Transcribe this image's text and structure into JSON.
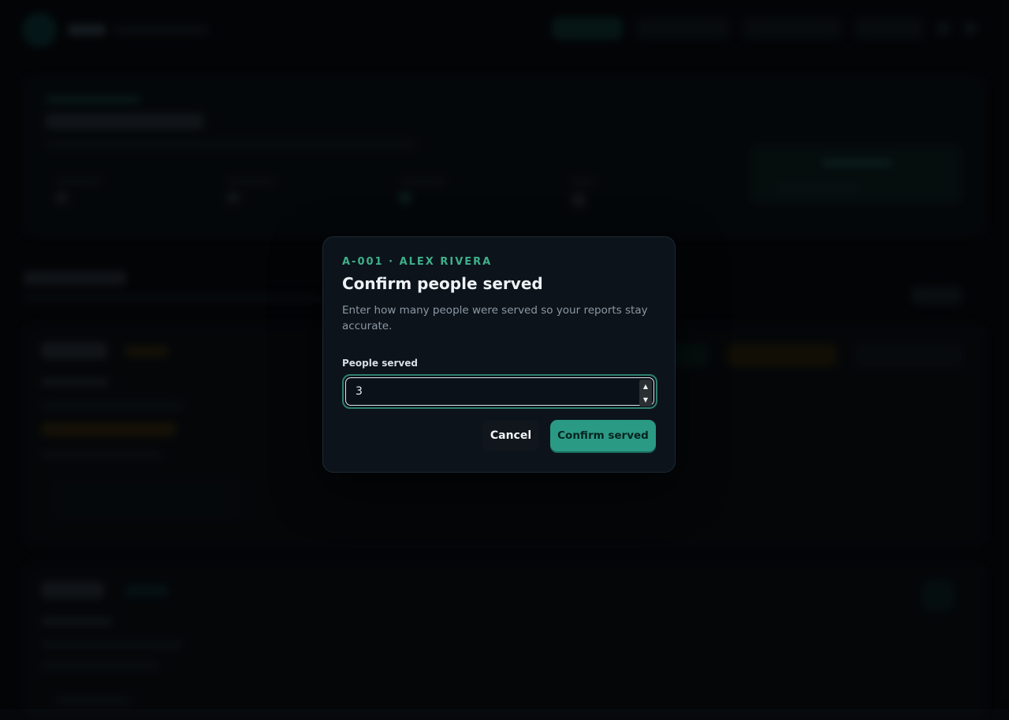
{
  "modal": {
    "kicker": "A-001 · ALEX RIVERA",
    "title": "Confirm people served",
    "description": "Enter how many people were served so your reports stay accurate.",
    "field_label": "People served",
    "field_value": "3",
    "spinner_up_icon": "triangle-up-icon",
    "spinner_down_icon": "triangle-down-icon",
    "cancel_label": "Cancel",
    "confirm_label": "Confirm served"
  },
  "colors": {
    "accent": "#2a9a85",
    "kicker": "#3fb08a",
    "background": "#05070a",
    "modal_bg": "#0c131b"
  }
}
